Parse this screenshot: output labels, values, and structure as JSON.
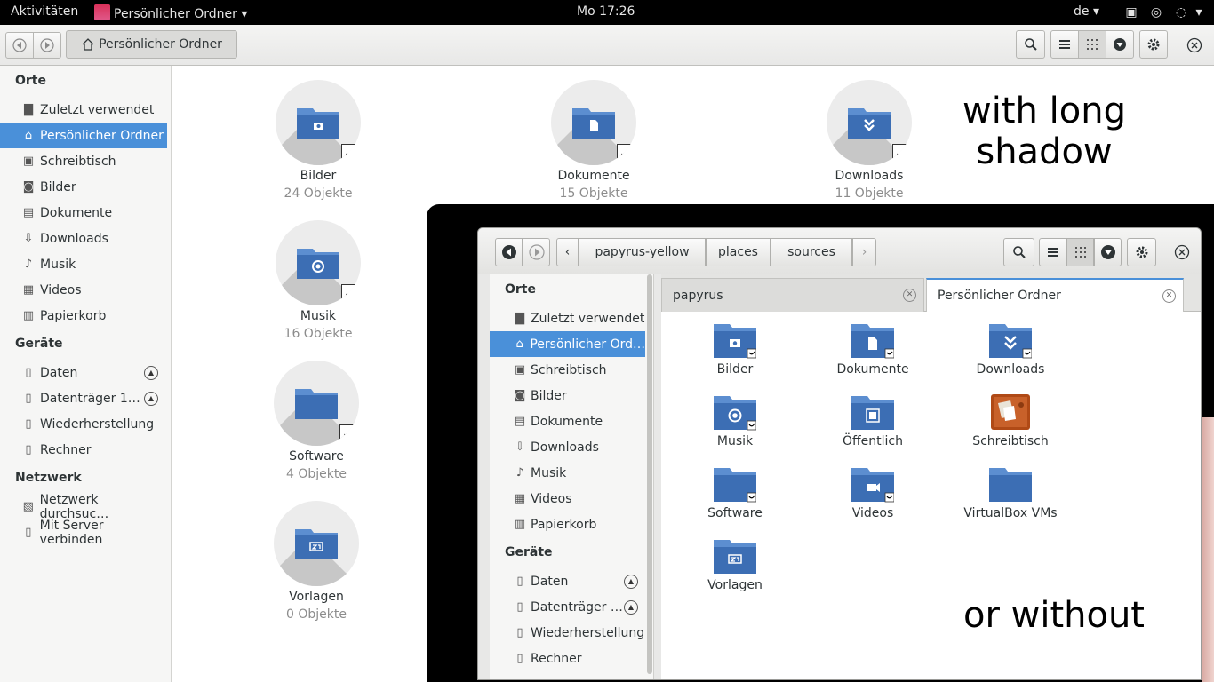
{
  "topbar": {
    "activities": "Aktivitäten",
    "app_menu": "Persönlicher Ordner ▾",
    "clock": "Mo 17:26",
    "language": "de ▾"
  },
  "header": {
    "path_label": "Persönlicher Ordner"
  },
  "sidebar": {
    "orte_heading": "Orte",
    "orte": [
      {
        "label": "Zuletzt verwendet",
        "icon": "recent-icon"
      },
      {
        "label": "Persönlicher Ordner",
        "icon": "home-icon",
        "selected": true
      },
      {
        "label": "Schreibtisch",
        "icon": "desktop-icon"
      },
      {
        "label": "Bilder",
        "icon": "camera-icon"
      },
      {
        "label": "Dokumente",
        "icon": "document-icon"
      },
      {
        "label": "Downloads",
        "icon": "download-icon"
      },
      {
        "label": "Musik",
        "icon": "music-icon"
      },
      {
        "label": "Videos",
        "icon": "film-icon"
      },
      {
        "label": "Papierkorb",
        "icon": "trash-icon"
      }
    ],
    "geraete_heading": "Geräte",
    "geraete": [
      {
        "label": "Daten",
        "eject": true
      },
      {
        "label": "Datenträger 1…",
        "eject": true
      },
      {
        "label": "Wiederherstellung",
        "eject": false
      },
      {
        "label": "Rechner",
        "eject": false
      }
    ],
    "netzwerk_heading": "Netzwerk",
    "netzwerk": [
      {
        "label": "Netzwerk durchsuc…"
      },
      {
        "label": "Mit Server verbinden"
      }
    ]
  },
  "files": [
    {
      "name": "Bilder",
      "count": "24 Objekte",
      "emblem": "camera"
    },
    {
      "name": "Dokumente",
      "count": "15 Objekte",
      "emblem": "document"
    },
    {
      "name": "Downloads",
      "count": "11 Objekte",
      "emblem": "download"
    },
    {
      "name": "Musik",
      "count": "16 Objekte",
      "emblem": "music"
    },
    {
      "name": "Software",
      "count": "4 Objekte",
      "emblem": "none"
    },
    {
      "name": "Vorlagen",
      "count": "0 Objekte",
      "emblem": "template"
    }
  ],
  "annotations": {
    "with_long_shadow": "with long\nshadow",
    "or_without": "or without"
  },
  "inner": {
    "breadcrumbs": [
      "papyrus-yellow",
      "places",
      "sources"
    ],
    "sidebar": {
      "orte_heading": "Orte",
      "orte": [
        {
          "label": "Zuletzt verwendet"
        },
        {
          "label": "Persönlicher Ord…",
          "selected": true
        },
        {
          "label": "Schreibtisch"
        },
        {
          "label": "Bilder"
        },
        {
          "label": "Dokumente"
        },
        {
          "label": "Downloads"
        },
        {
          "label": "Musik"
        },
        {
          "label": "Videos"
        },
        {
          "label": "Papierkorb"
        }
      ],
      "geraete_heading": "Geräte",
      "geraete": [
        {
          "label": "Daten",
          "eject": true
        },
        {
          "label": "Datenträger …",
          "eject": true
        },
        {
          "label": "Wiederherstellung",
          "eject": false
        },
        {
          "label": "Rechner",
          "eject": false
        }
      ]
    },
    "tabs": [
      {
        "label": "papyrus",
        "active": false
      },
      {
        "label": "Persönlicher Ordner",
        "active": true
      }
    ],
    "files": [
      {
        "name": "Bilder",
        "kind": "camera"
      },
      {
        "name": "Dokumente",
        "kind": "document"
      },
      {
        "name": "Downloads",
        "kind": "download"
      },
      {
        "name": "Musik",
        "kind": "music"
      },
      {
        "name": "Öffentlich",
        "kind": "public"
      },
      {
        "name": "Schreibtisch",
        "kind": "desktop"
      },
      {
        "name": "Software",
        "kind": "plain-check"
      },
      {
        "name": "Videos",
        "kind": "video"
      },
      {
        "name": "VirtualBox VMs",
        "kind": "plain"
      },
      {
        "name": "Vorlagen",
        "kind": "template"
      }
    ]
  },
  "colors": {
    "folder_blue": "#3c6eb4",
    "folder_tab": "#5c8ed0",
    "selection": "#4a90d9"
  }
}
